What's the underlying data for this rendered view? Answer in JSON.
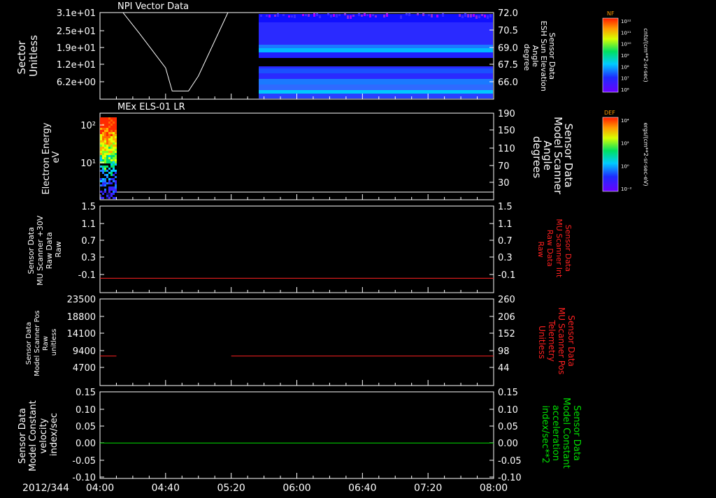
{
  "date_label": "2012/344",
  "x_ticks": [
    "04:00",
    "04:40",
    "05:20",
    "06:00",
    "06:40",
    "07:20",
    "08:00"
  ],
  "chart_data": [
    {
      "type": "heatmap",
      "title": "NPI Vector Data",
      "ylabel_left": [
        "Sector",
        "Unitless"
      ],
      "ylabel_right": [
        "Sensor Data",
        "ESH Sun Elevation",
        "Angle",
        "degree"
      ],
      "yticks_left": [
        "3.1e+01",
        "2.5e+01",
        "1.9e+01",
        "1.2e+01",
        "6.2e+00"
      ],
      "yticks_right": [
        "72.0",
        "70.5",
        "69.0",
        "67.5",
        "66.0"
      ],
      "line_series": {
        "name": "ESH Sun Elevation Angle",
        "x": [
          "04:00",
          "04:14",
          "04:24",
          "04:40",
          "04:44",
          "04:54",
          "05:00",
          "05:18",
          "08:00"
        ],
        "y": [
          72.0,
          72.0,
          70.2,
          67.2,
          65.2,
          65.2,
          66.5,
          72.0,
          72.0
        ]
      },
      "heatmap_extent": {
        "x_start": "05:40",
        "x_end": "08:00"
      }
    },
    {
      "type": "heatmap",
      "title": "MEx ELS-01 LR",
      "ylabel_left": [
        "Electron Energy",
        "eV"
      ],
      "ylabel_right": [
        "Sensor Data",
        "Model Scanner",
        "Angle",
        "degrees"
      ],
      "yticks_left": [
        "10²",
        "10¹"
      ],
      "yticks_right": [
        "190",
        "150",
        "110",
        "70",
        "30"
      ],
      "heatmap_extent": {
        "x_start": "04:00",
        "x_end": "04:10"
      }
    },
    {
      "type": "line",
      "ylabel_left": [
        "Sensor Data",
        "MU Scanner +30V",
        "Raw Data",
        "Raw"
      ],
      "ylabel_right": [
        "Sensor Data",
        "MU Scanner Int",
        "Raw Data",
        "Raw"
      ],
      "yticks_left": [
        "1.5",
        "1.1",
        "0.7",
        "0.3",
        "-0.1"
      ],
      "yticks_right": [
        "1.5",
        "1.1",
        "0.7",
        "0.3",
        "-0.1"
      ],
      "ylim": [
        -0.3,
        1.5
      ],
      "series": [
        {
          "x": [
            "04:00",
            "08:00"
          ],
          "y": [
            0.0,
            0.0
          ],
          "color": "#ff2020"
        }
      ]
    },
    {
      "type": "line",
      "ylabel_left": [
        "Sensor Data",
        "Model Scanner Pos",
        "Raw",
        "unitless"
      ],
      "ylabel_right": [
        "Sensor Data",
        "MU Scanner Pos",
        "Telemetry",
        "Unitless"
      ],
      "yticks_left": [
        "23500",
        "18800",
        "14100",
        "9400",
        "4700"
      ],
      "yticks_right": [
        "260",
        "206",
        "152",
        "98",
        "44"
      ],
      "ylim": [
        0,
        23500
      ],
      "series": [
        {
          "x": [
            "04:00",
            "04:10"
          ],
          "y": [
            8000,
            8000
          ],
          "color": "#ff2020"
        },
        {
          "x": [
            "05:20",
            "08:00"
          ],
          "y": [
            8000,
            8000
          ],
          "color": "#ff2020"
        }
      ]
    },
    {
      "type": "line",
      "ylabel_left": [
        "Sensor Data",
        "Model Constant",
        "velocity",
        "index/sec"
      ],
      "ylabel_right": [
        "Sensor Data",
        "Model Constant",
        "acceleration",
        "index/sec**2"
      ],
      "yticks_left": [
        "0.15",
        "0.10",
        "0.05",
        "0.00",
        "-0.05",
        "-0.10"
      ],
      "yticks_right": [
        "0.15",
        "0.10",
        "0.05",
        "0.00",
        "-0.05",
        "-0.10"
      ],
      "ylim": [
        -0.1,
        0.15
      ],
      "series": [
        {
          "x": [
            "04:00",
            "08:00"
          ],
          "y": [
            0.0,
            0.0
          ],
          "color": "#00e000"
        }
      ]
    }
  ],
  "colorbars": [
    {
      "label": "NF",
      "unit": "cnts/(cm**2-sr-sec)",
      "ticks": [
        "10¹²",
        "10¹¹",
        "10¹⁰",
        "10⁹",
        "10⁸",
        "10⁷",
        "10⁶"
      ]
    },
    {
      "label": "DEF",
      "unit": "ergs/(cm**2-sr-sec-eV)",
      "ticks": [
        "10⁴",
        "10²",
        "10⁰",
        "10⁻²"
      ]
    }
  ],
  "colors": {
    "right_label_panel3": "#ff2020",
    "right_label_panel4": "#ff2020",
    "right_label_panel5": "#00e000"
  }
}
